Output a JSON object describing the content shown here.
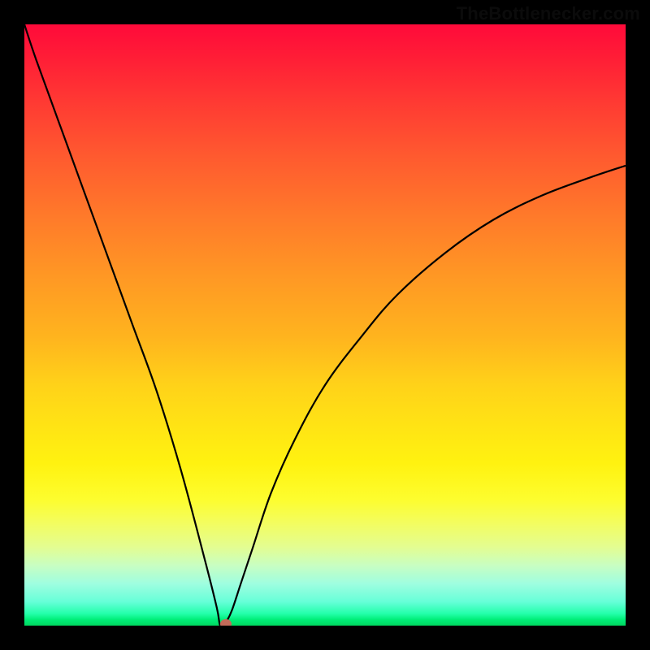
{
  "watermark": {
    "text": "TheBottlenecker.com"
  },
  "chart_data": {
    "type": "line",
    "title": "",
    "xlabel": "",
    "ylabel": "",
    "xlim": [
      0,
      100
    ],
    "ylim": [
      0,
      100
    ],
    "grid": false,
    "legend": false,
    "series": [
      {
        "name": "curve",
        "x": [
          0,
          2,
          6,
          10,
          14,
          18,
          22,
          26,
          30,
          32,
          32.5,
          33,
          33.5,
          34.5,
          36,
          38,
          41,
          45,
          50,
          56,
          62,
          70,
          78,
          86,
          94,
          100
        ],
        "y": [
          100,
          94,
          83,
          72,
          61,
          50,
          39,
          26,
          11,
          3,
          0.2,
          0,
          0.5,
          2.5,
          7,
          13,
          22,
          31,
          40,
          48,
          55,
          62,
          67.5,
          71.5,
          74.5,
          76.5
        ]
      }
    ],
    "marker": {
      "x": 33.5,
      "y": 0.3
    },
    "background_gradient": {
      "stops": [
        {
          "pct": 0,
          "color": "#ff0a3a"
        },
        {
          "pct": 50,
          "color": "#ffb41e"
        },
        {
          "pct": 78,
          "color": "#fdfd2e"
        },
        {
          "pct": 95,
          "color": "#67ffd8"
        },
        {
          "pct": 100,
          "color": "#00d860"
        }
      ]
    }
  }
}
